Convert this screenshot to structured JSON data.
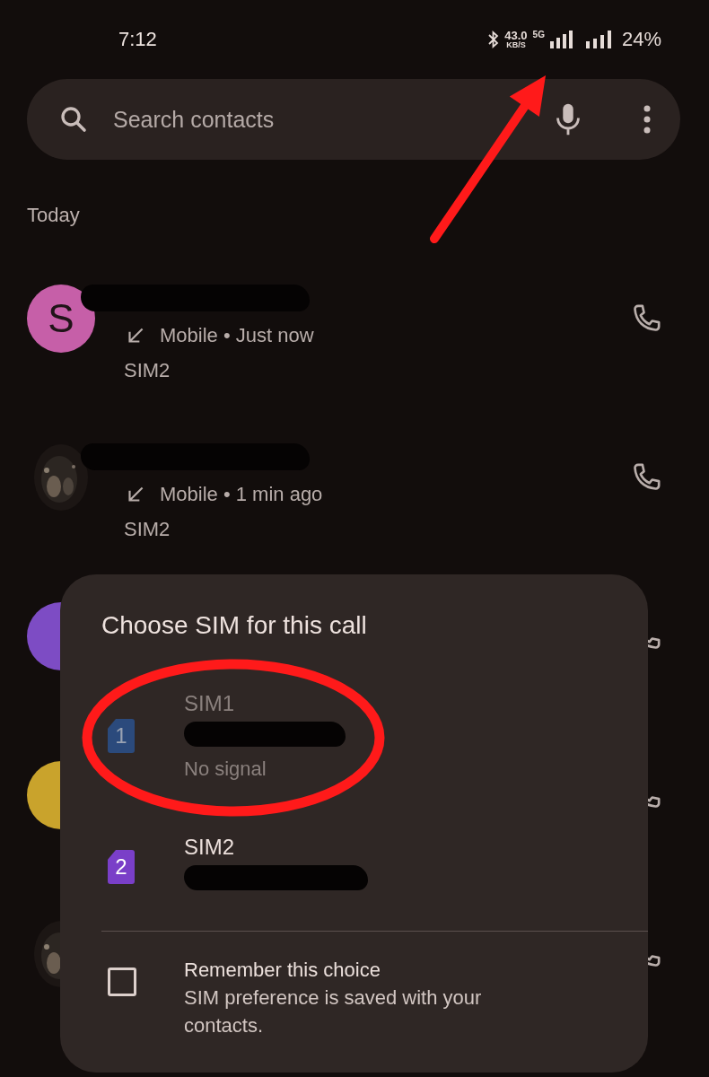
{
  "status_bar": {
    "time": "7:12",
    "speed": "43.0",
    "speed_unit": "KB/S",
    "network": "5G",
    "battery": "24%"
  },
  "search": {
    "placeholder": "Search contacts"
  },
  "section": "Today",
  "calls": [
    {
      "avatar": {
        "kind": "letter",
        "letter": "S",
        "color": "#c65fa8"
      },
      "name_redacted": true,
      "detail": "Mobile • Just now",
      "sim": "SIM2"
    },
    {
      "avatar": {
        "kind": "picture"
      },
      "name_redacted": true,
      "detail": "Mobile • 1 min ago",
      "sim": "SIM2"
    },
    {
      "avatar": {
        "kind": "letter",
        "color": "#7d4cc4"
      }
    },
    {
      "avatar": {
        "kind": "letter",
        "color": "#c9a32c"
      }
    },
    {
      "avatar": {
        "kind": "picture"
      }
    }
  ],
  "dialog": {
    "title": "Choose SIM for this call",
    "options": [
      {
        "number": "1",
        "label": "SIM1",
        "redacted": true,
        "status": "No signal",
        "disabled": true,
        "color": "#2b4a7c"
      },
      {
        "number": "2",
        "label": "SIM2",
        "redacted": true,
        "disabled": false,
        "color": "#7a3fc8"
      }
    ],
    "remember": {
      "label": "Remember this choice",
      "hint": "SIM preference is saved with your contacts.",
      "checked": false
    }
  },
  "annotations": [
    {
      "kind": "arrow"
    },
    {
      "kind": "ellipse"
    }
  ]
}
